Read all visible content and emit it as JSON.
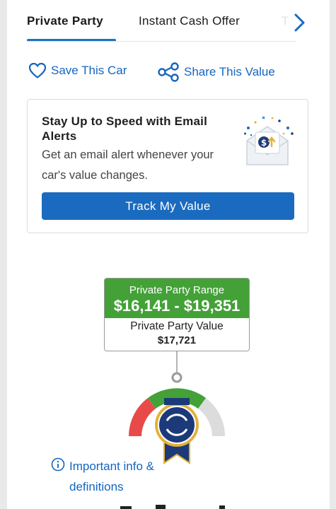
{
  "tabs": [
    {
      "label": "Private Party",
      "active": true
    },
    {
      "label": "Instant Cash Offer",
      "active": false
    },
    {
      "label": "T",
      "active": false
    }
  ],
  "actions": {
    "save_label": "Save This Car",
    "share_label": "Share This Value"
  },
  "email_alert": {
    "title": "Stay Up to Speed with Email Alerts",
    "description": "Get an email alert whenever your car's value changes.",
    "button_label": "Track My Value"
  },
  "value_box": {
    "range_label": "Private Party Range",
    "range_value": "$16,141 - $19,351",
    "value_label": "Private Party Value",
    "value": "$17,721"
  },
  "info": {
    "label": "Important info & definitions"
  },
  "colors": {
    "accent_blue": "#1a6bbf",
    "link_blue": "#1565c0",
    "range_green": "#43a137",
    "gauge_red": "#e84a4a",
    "gauge_gray": "#dcdcdc",
    "badge_navy": "#1c3a7a",
    "badge_gold": "#e2b23a"
  }
}
